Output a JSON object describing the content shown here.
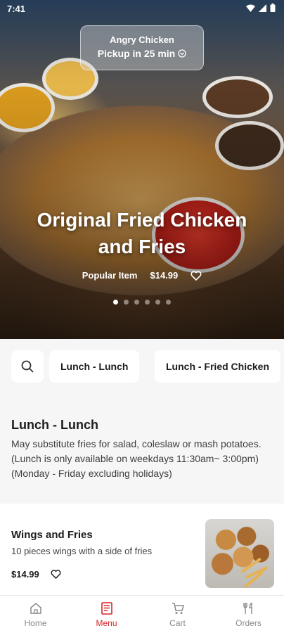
{
  "status_bar": {
    "time": "7:41",
    "icons": [
      "wifi-icon",
      "signal-icon",
      "battery-icon"
    ]
  },
  "store": {
    "name": "Angry Chicken",
    "pickup": "Pickup in 25 min"
  },
  "hero": {
    "title_line1": "Original Fried Chicken",
    "title_line2": "and Fries",
    "badge": "Popular Item",
    "price": "$14.99",
    "slides_total": 6,
    "slide_active": 1
  },
  "categories": [
    "Lunch - Lunch",
    "Lunch - Fried Chicken"
  ],
  "section": {
    "title": "Lunch - Lunch",
    "description": "May substitute fries for salad, coleslaw or mash potatoes. (Lunch is only available on weekdays 11:30am~ 3:00pm) (Monday - Friday excluding holidays)"
  },
  "item": {
    "name": "Wings and Fries",
    "description": "10 pieces wings with a side of fries",
    "price": "$14.99"
  },
  "nav": {
    "home": "Home",
    "menu": "Menu",
    "cart": "Cart",
    "orders": "Orders",
    "active": "Menu"
  },
  "colors": {
    "accent": "#d8262c",
    "inactive": "#8a8a8a"
  }
}
